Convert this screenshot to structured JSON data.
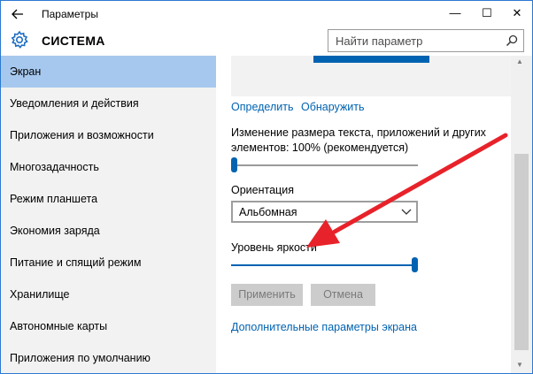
{
  "window": {
    "title": "Параметры",
    "back_icon": "arrow-left-icon",
    "minimize_glyph": "—",
    "maximize_glyph": "☐",
    "close_glyph": "✕"
  },
  "header": {
    "app_title": "СИСТЕМА",
    "app_icon": "gear-icon",
    "search_placeholder": "Найти параметр",
    "search_icon": "search-icon"
  },
  "sidebar": {
    "items": [
      {
        "label": "Экран",
        "active": true
      },
      {
        "label": "Уведомления и действия",
        "active": false
      },
      {
        "label": "Приложения и возможности",
        "active": false
      },
      {
        "label": "Многозадачность",
        "active": false
      },
      {
        "label": "Режим планшета",
        "active": false
      },
      {
        "label": "Экономия заряда",
        "active": false
      },
      {
        "label": "Питание и спящий режим",
        "active": false
      },
      {
        "label": "Хранилище",
        "active": false
      },
      {
        "label": "Автономные карты",
        "active": false
      },
      {
        "label": "Приложения по умолчанию",
        "active": false
      }
    ]
  },
  "display": {
    "identify_link": "Определить",
    "detect_link": "Обнаружить",
    "scale_label": "Изменение размера текста, приложений и других элементов: 100% (рекомендуется)",
    "scale_label_line1": "Изменение размера текста, приложений и других",
    "scale_label_line2": "элементов: 100% (рекомендуется)",
    "scale_level": 0,
    "orientation_label": "Ориентация",
    "orientation_value": "Альбомная",
    "brightness_label": "Уровень яркости",
    "brightness_level": 1.0,
    "apply_button": "Применить",
    "cancel_button": "Отмена",
    "advanced_link": "Дополнительные параметры экрана"
  },
  "colors": {
    "accent": "#0063b1",
    "active_nav": "#a6c8ee",
    "annotation_arrow": "#e8222a"
  }
}
